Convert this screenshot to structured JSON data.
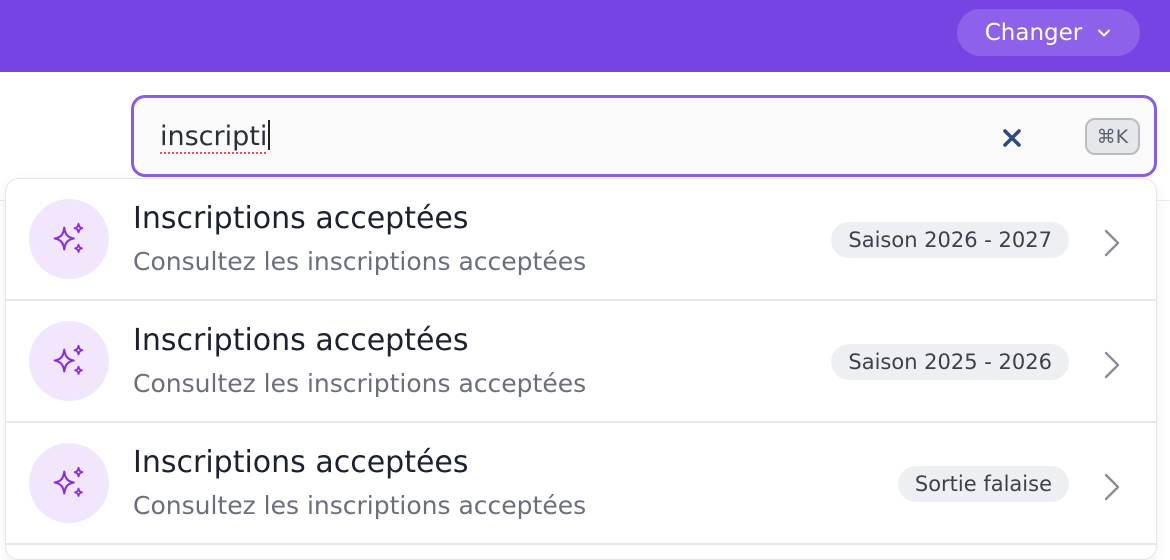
{
  "header": {
    "switch_label": "Changer",
    "switch_icon": "chevron-down-icon"
  },
  "search": {
    "query": "inscripti",
    "clear_icon": "close-icon",
    "shortcut": "⌘K",
    "border_color": "#8a5ce6"
  },
  "colors": {
    "brand": "#7744e3",
    "icon_accent": "#8b2be2",
    "icon_bg": "#f1e6fb"
  },
  "results": [
    {
      "icon": "sparkles-icon",
      "title": "Inscriptions acceptées",
      "subtitle": "Consultez les inscriptions acceptées",
      "badge": "Saison 2026 - 2027"
    },
    {
      "icon": "sparkles-icon",
      "title": "Inscriptions acceptées",
      "subtitle": "Consultez les inscriptions acceptées",
      "badge": "Saison 2025 - 2026"
    },
    {
      "icon": "sparkles-icon",
      "title": "Inscriptions acceptées",
      "subtitle": "Consultez les inscriptions acceptées",
      "badge": "Sortie falaise"
    }
  ]
}
